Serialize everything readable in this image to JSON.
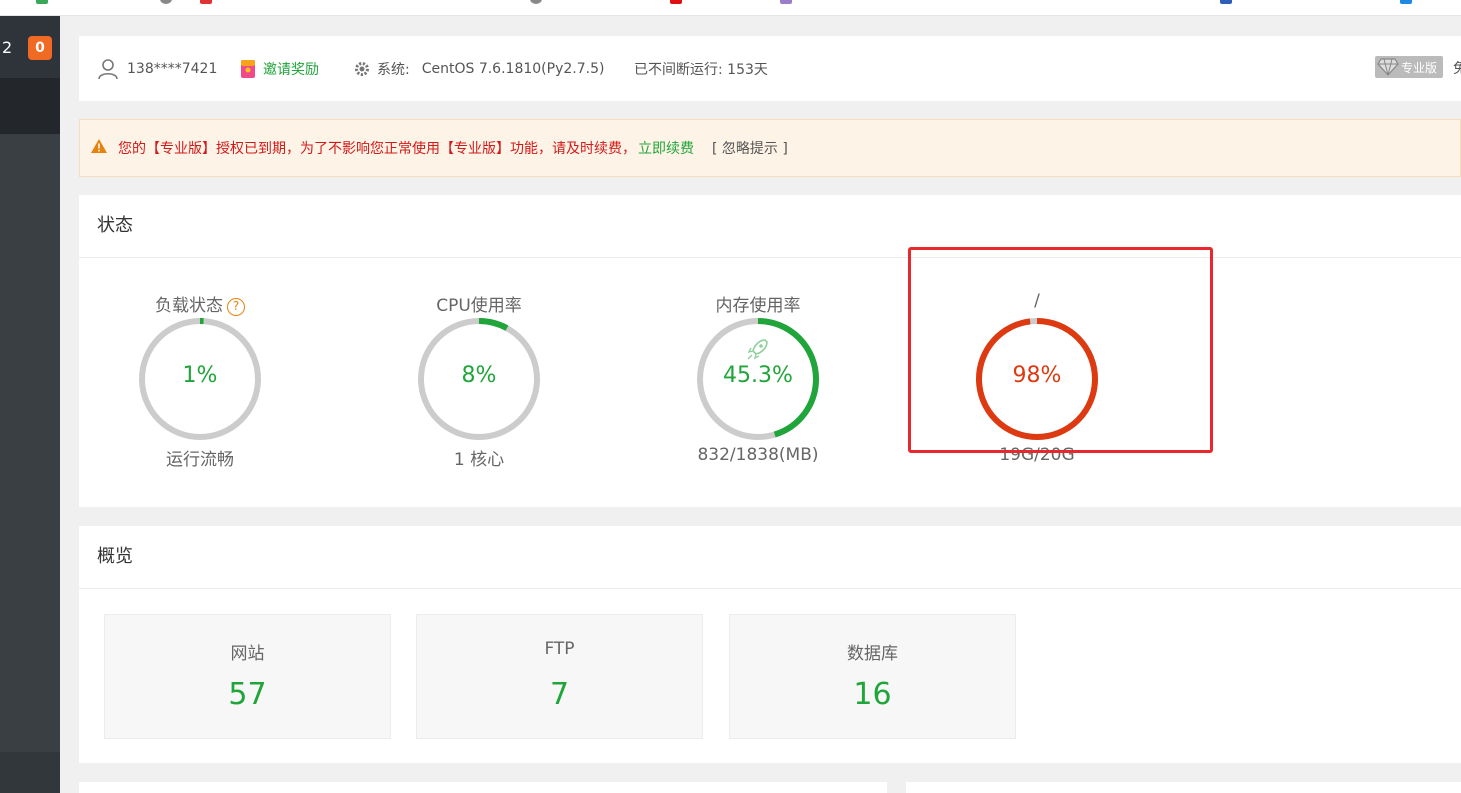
{
  "sidebar": {
    "number": "2",
    "badge": "0"
  },
  "header": {
    "phone": "138****7421",
    "invite_label": "邀请奖励",
    "system_label": "系统:",
    "system_value": "CentOS 7.6.1810(Py2.7.5)",
    "uptime": "已不间断运行: 153天",
    "pro_label": "专业版",
    "cut_text": "免"
  },
  "alert": {
    "message": "您的【专业版】授权已到期，为了不影响您正常使用【专业版】功能，请及时续费，",
    "renew_link": "立即续费",
    "ignore_link": "[ 忽略提示 ]"
  },
  "status": {
    "title": "状态",
    "gauges": [
      {
        "title": "负载状态",
        "value_text": "1%",
        "percent": 1,
        "sub": "运行流畅",
        "color": "#20a53a"
      },
      {
        "title": "CPU使用率",
        "value_text": "8%",
        "percent": 8,
        "sub": "1 核心",
        "color": "#20a53a"
      },
      {
        "title": "内存使用率",
        "value_text": "45.3%",
        "percent": 45.3,
        "sub": "832/1838(MB)",
        "color": "#20a53a",
        "icon": "rocket-icon"
      },
      {
        "title": "/",
        "value_text": "98%",
        "percent": 98,
        "sub": "19G/20G",
        "color": "#dd3a12"
      }
    ]
  },
  "overview": {
    "title": "概览",
    "boxes": [
      {
        "label": "网站",
        "value": "57"
      },
      {
        "label": "FTP",
        "value": "7"
      },
      {
        "label": "数据库",
        "value": "16"
      }
    ]
  },
  "colors": {
    "accent_green": "#20a53a",
    "danger": "#dd3a12",
    "warning": "#e6820e",
    "track": "#cccccc"
  }
}
